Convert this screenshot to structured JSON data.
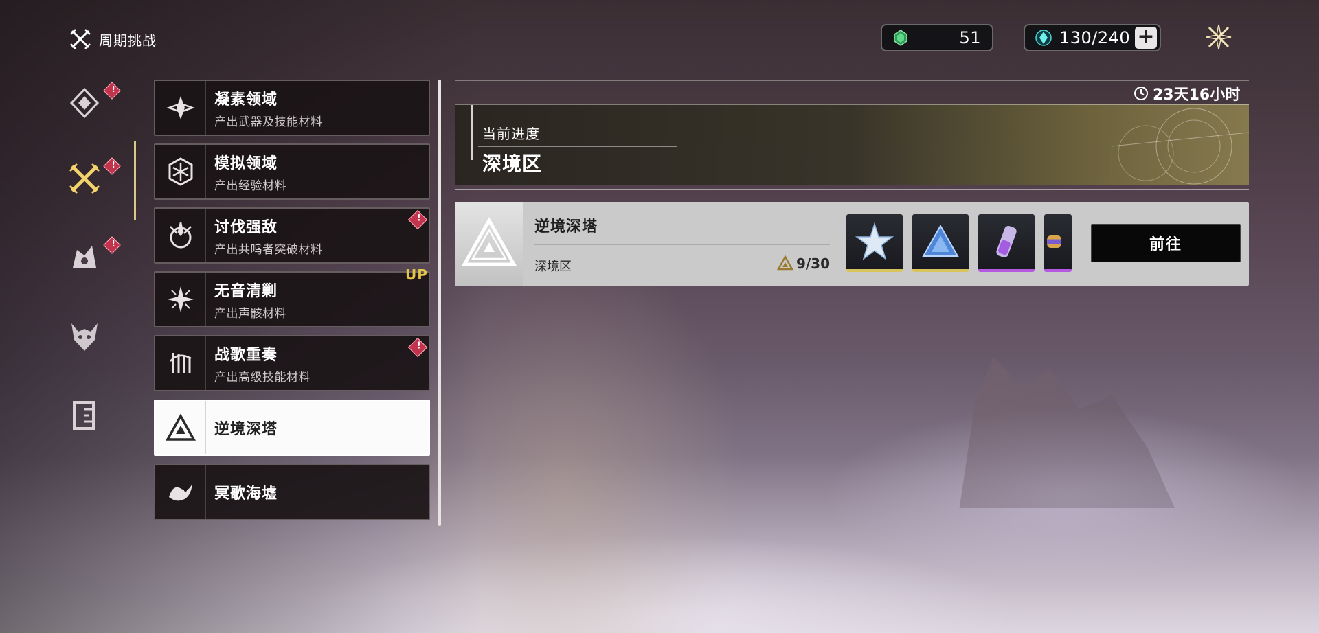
{
  "header": {
    "title": "周期挑战",
    "title_icon": "crossed-swords-icon"
  },
  "currencies": [
    {
      "icon": "green-crystal-icon",
      "value": "51"
    },
    {
      "icon": "cyan-crystal-icon",
      "value": "130/240",
      "plus": "+"
    }
  ],
  "sidebar": {
    "items": [
      {
        "icon": "diamond-emblem-icon",
        "alert": true
      },
      {
        "icon": "crossed-swords-icon",
        "alert": true,
        "active": true
      },
      {
        "icon": "beast-emblem-icon",
        "alert": true
      },
      {
        "icon": "demon-mask-icon",
        "alert": false
      },
      {
        "icon": "door-icon",
        "alert": false
      }
    ]
  },
  "list": {
    "items": [
      {
        "name": "凝素领域",
        "sub": "产出武器及技能材料",
        "icon": "crystal-cluster-icon",
        "alert": false
      },
      {
        "name": "模拟领域",
        "sub": "产出经验材料",
        "icon": "hex-emblem-icon",
        "alert": false
      },
      {
        "name": "讨伐强敌",
        "sub": "产出共鸣者突破材料",
        "icon": "claw-emblem-icon",
        "alert": true
      },
      {
        "name": "无音清剿",
        "sub": "产出声骸材料",
        "icon": "sparkle-icon",
        "alert": false
      },
      {
        "name": "战歌重奏",
        "sub": "产出高级技能材料",
        "icon": "music-emblem-icon",
        "alert": true
      },
      {
        "name": "逆境深塔",
        "sub": "",
        "icon": "triangle-tower-icon",
        "alert": false,
        "active": true
      },
      {
        "name": "冥歌海墟",
        "sub": "",
        "icon": "sea-serpent-icon",
        "alert": false
      }
    ],
    "up_badge": "UP"
  },
  "panel": {
    "timer": "23天16小时",
    "progress_label": "当前进度",
    "progress_value": "深境区",
    "stage": {
      "name": "逆境深塔",
      "area": "深境区",
      "progress": "9/30"
    },
    "rewards": [
      {
        "icon": "star-crystal-icon",
        "rarity": "gold"
      },
      {
        "icon": "blue-triangle-icon",
        "rarity": "gold"
      },
      {
        "icon": "potion-tube-icon",
        "rarity": "purple"
      },
      {
        "icon": "capsule-icon",
        "rarity": "purple"
      }
    ],
    "go_button": "前往"
  }
}
